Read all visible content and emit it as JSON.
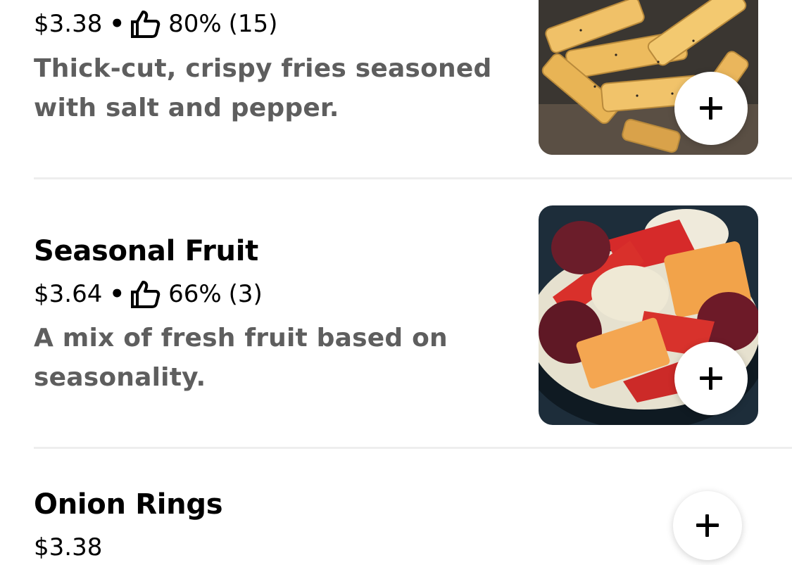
{
  "menu": {
    "items": [
      {
        "name": "",
        "price": "$3.38",
        "rating": "80%",
        "rating_count": "(15)",
        "description": "Thick-cut, crispy fries seasoned with salt and pepper.",
        "image_icon": "fries-image",
        "add_icon": "plus-icon"
      },
      {
        "name": "Seasonal Fruit",
        "price": "$3.64",
        "rating": "66%",
        "rating_count": "(3)",
        "description": "A mix of fresh fruit based on seasonality.",
        "image_icon": "fruit-bowl-image",
        "add_icon": "plus-icon"
      },
      {
        "name": "Onion Rings",
        "price": "$3.38",
        "add_icon": "plus-icon"
      }
    ],
    "separator": "•",
    "thumb_icon": "thumbs-up-icon"
  },
  "colors": {
    "text_primary": "#000000",
    "text_secondary": "#5e5e5e",
    "divider": "#eeeeee",
    "button_bg": "#ffffff"
  }
}
